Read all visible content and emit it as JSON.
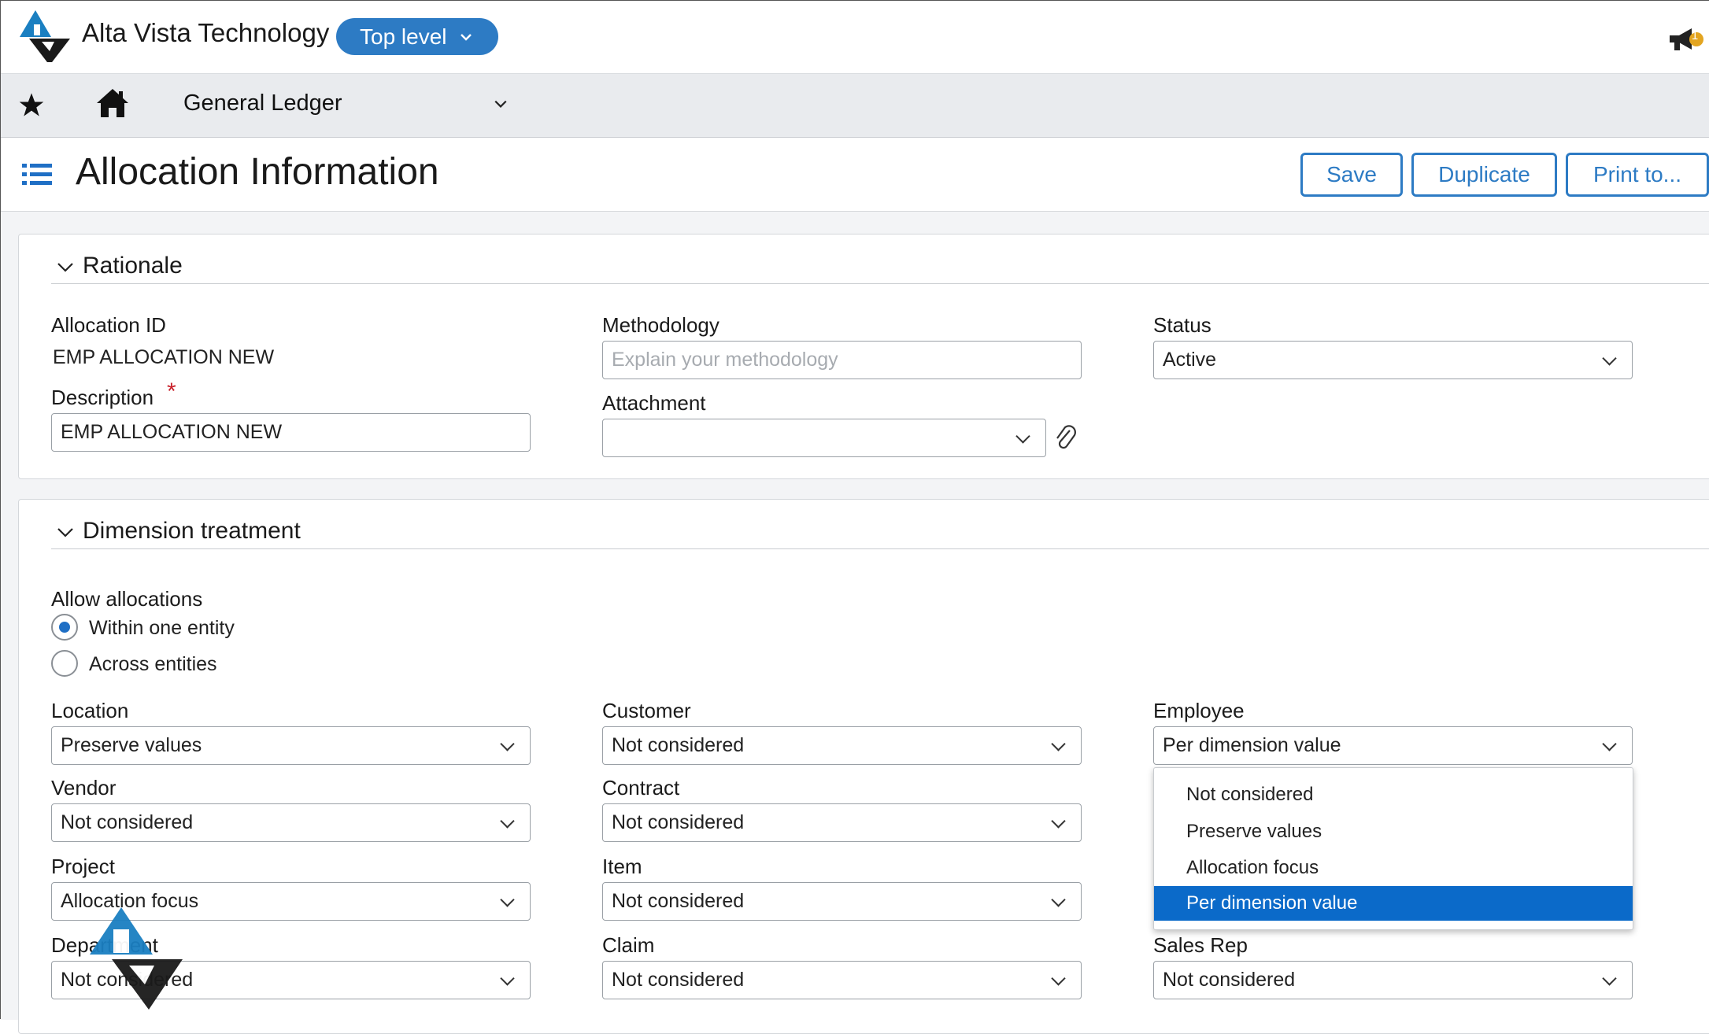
{
  "header": {
    "company": "Alta Vista Technology",
    "level_button": "Top level",
    "module": "General Ledger"
  },
  "page": {
    "title": "Allocation Information",
    "buttons": {
      "save": "Save",
      "duplicate": "Duplicate",
      "print": "Print to..."
    }
  },
  "rationale": {
    "title": "Rationale",
    "allocation_id_label": "Allocation ID",
    "allocation_id_value": "EMP ALLOCATION NEW",
    "description_label": "Description",
    "required_marker": "*",
    "description_value": "EMP ALLOCATION NEW",
    "methodology_label": "Methodology",
    "methodology_placeholder": "Explain your methodology",
    "attachment_label": "Attachment",
    "status_label": "Status",
    "status_value": "Active"
  },
  "dimension": {
    "title": "Dimension treatment",
    "allow_label": "Allow allocations",
    "radio_within": "Within one entity",
    "radio_across": "Across entities",
    "location_label": "Location",
    "location_value": "Preserve values",
    "customer_label": "Customer",
    "customer_value": "Not considered",
    "employee_label": "Employee",
    "employee_value": "Per dimension value",
    "vendor_label": "Vendor",
    "vendor_value": "Not considered",
    "contract_label": "Contract",
    "contract_value": "Not considered",
    "project_label": "Project",
    "project_value": "Allocation focus",
    "item_label": "Item",
    "item_value": "Not considered",
    "department_label": "Department",
    "department_value": "Not considered",
    "claim_label": "Claim",
    "claim_value": "Not considered",
    "salesrep_label": "Sales Rep",
    "salesrep_value": "Not considered"
  },
  "dropdown_options": [
    "Not considered",
    "Preserve values",
    "Allocation focus",
    "Per dimension value"
  ],
  "notification_count": "1",
  "colors": {
    "accent": "#2d7bc4",
    "selected": "#0b6ac9",
    "logo_blue": "#1a7fc1"
  }
}
